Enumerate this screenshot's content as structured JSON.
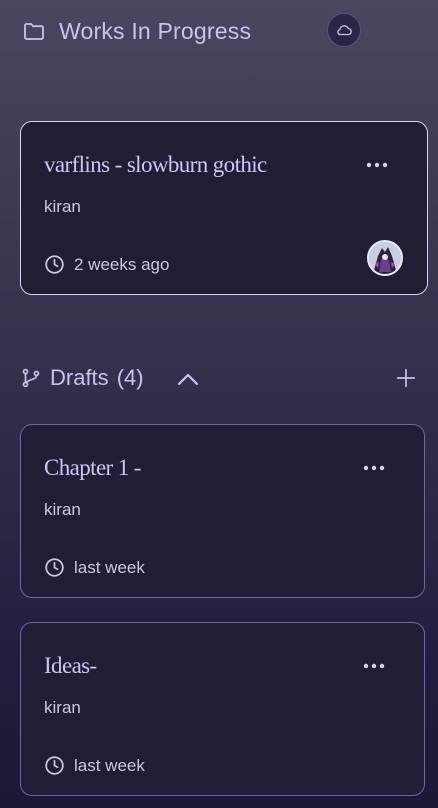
{
  "section": {
    "title": "Works In Progress",
    "icon": "folder-icon",
    "cloud_icon": "cloud-icon"
  },
  "works": [
    {
      "title": "varflins - slowburn gothic",
      "author": "kiran",
      "time": "2 weeks ago",
      "more_icon": "more-horizontal-icon",
      "avatar": "avatar"
    }
  ],
  "drafts": {
    "title": "Drafts",
    "count": "(4)",
    "icon": "branch-icon",
    "collapse_icon": "chevron-up-icon",
    "add_icon": "plus-icon",
    "items": [
      {
        "title": "Chapter 1 -",
        "author": "kiran",
        "time": "last week"
      },
      {
        "title": "Ideas-",
        "author": "kiran",
        "time": "last week"
      }
    ]
  },
  "colors": {
    "accent": "#c9c3f2",
    "card_bg": "#211d34",
    "card_border_selected": "#d6d2f0",
    "card_border": "#6e64b4"
  }
}
